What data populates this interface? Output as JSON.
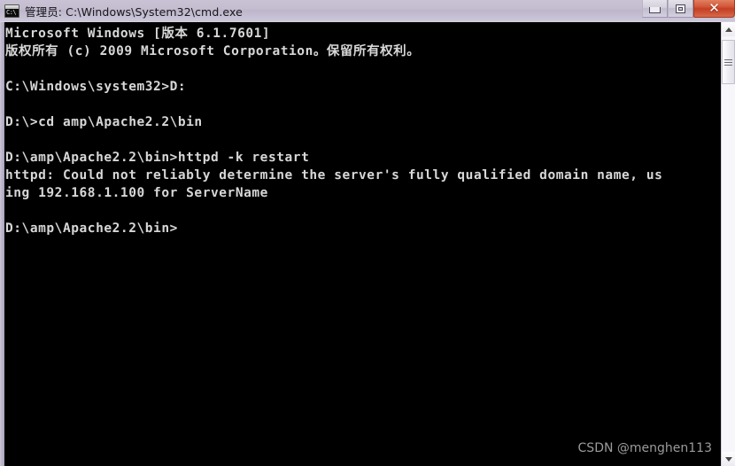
{
  "window": {
    "title": "管理员: C:\\Windows\\System32\\cmd.exe",
    "icon_name": "cmd-console-icon",
    "icon_glyph": "C:\\",
    "titlebar_color": "#c4bdd0",
    "close_button_color": "#c33f22",
    "controls": {
      "minimize_label": "Minimize",
      "restore_label": "Restore Down",
      "close_label": "Close",
      "close_glyph": "✕"
    }
  },
  "console": {
    "background_color": "#000000",
    "text_color": "#d7d7d7",
    "lines": [
      "Microsoft Windows [版本 6.1.7601]",
      "版权所有 (c) 2009 Microsoft Corporation。保留所有权利。",
      "",
      "C:\\Windows\\system32>D:",
      "",
      "D:\\>cd amp\\Apache2.2\\bin",
      "",
      "D:\\amp\\Apache2.2\\bin>httpd -k restart",
      "httpd: Could not reliably determine the server's fully qualified domain name, us",
      "ing 192.168.1.100 for ServerName",
      "",
      "D:\\amp\\Apache2.2\\bin>"
    ]
  },
  "watermark": {
    "text": "CSDN @menghen113"
  },
  "scrollbar": {
    "up_arrow_name": "scroll-up-arrow",
    "down_arrow_name": "scroll-down-arrow",
    "thumb_name": "scroll-thumb"
  }
}
